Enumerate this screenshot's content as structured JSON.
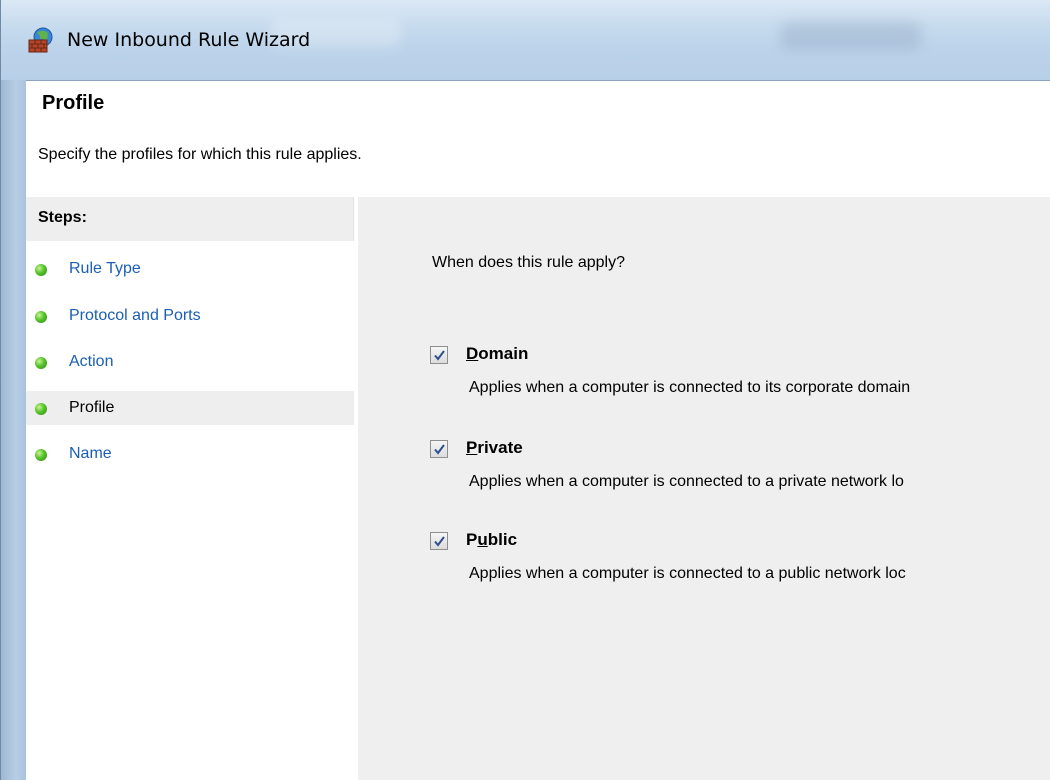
{
  "window": {
    "title": "New Inbound Rule Wizard",
    "icon": "firewall-icon"
  },
  "header": {
    "title": "Profile",
    "description": "Specify the profiles for which this rule applies."
  },
  "steps": {
    "heading": "Steps:",
    "items": [
      {
        "label": "Rule Type",
        "current": false
      },
      {
        "label": "Protocol and Ports",
        "current": false
      },
      {
        "label": "Action",
        "current": false
      },
      {
        "label": "Profile",
        "current": true
      },
      {
        "label": "Name",
        "current": false
      }
    ],
    "dot_color": "#4cb82a",
    "link_color": "#1a5fb4"
  },
  "content": {
    "question": "When does this rule apply?",
    "options": [
      {
        "label_accel": "D",
        "label_rest": "omain",
        "checked": true,
        "description": "Applies when a computer is connected to its corporate domain"
      },
      {
        "label_accel": "P",
        "label_rest": "rivate",
        "checked": true,
        "description": "Applies when a computer is connected to a private network lo"
      },
      {
        "label_pre": "P",
        "label_accel": "u",
        "label_rest": "blic",
        "checked": true,
        "description": "Applies when a computer is connected to a public network loc"
      }
    ]
  }
}
